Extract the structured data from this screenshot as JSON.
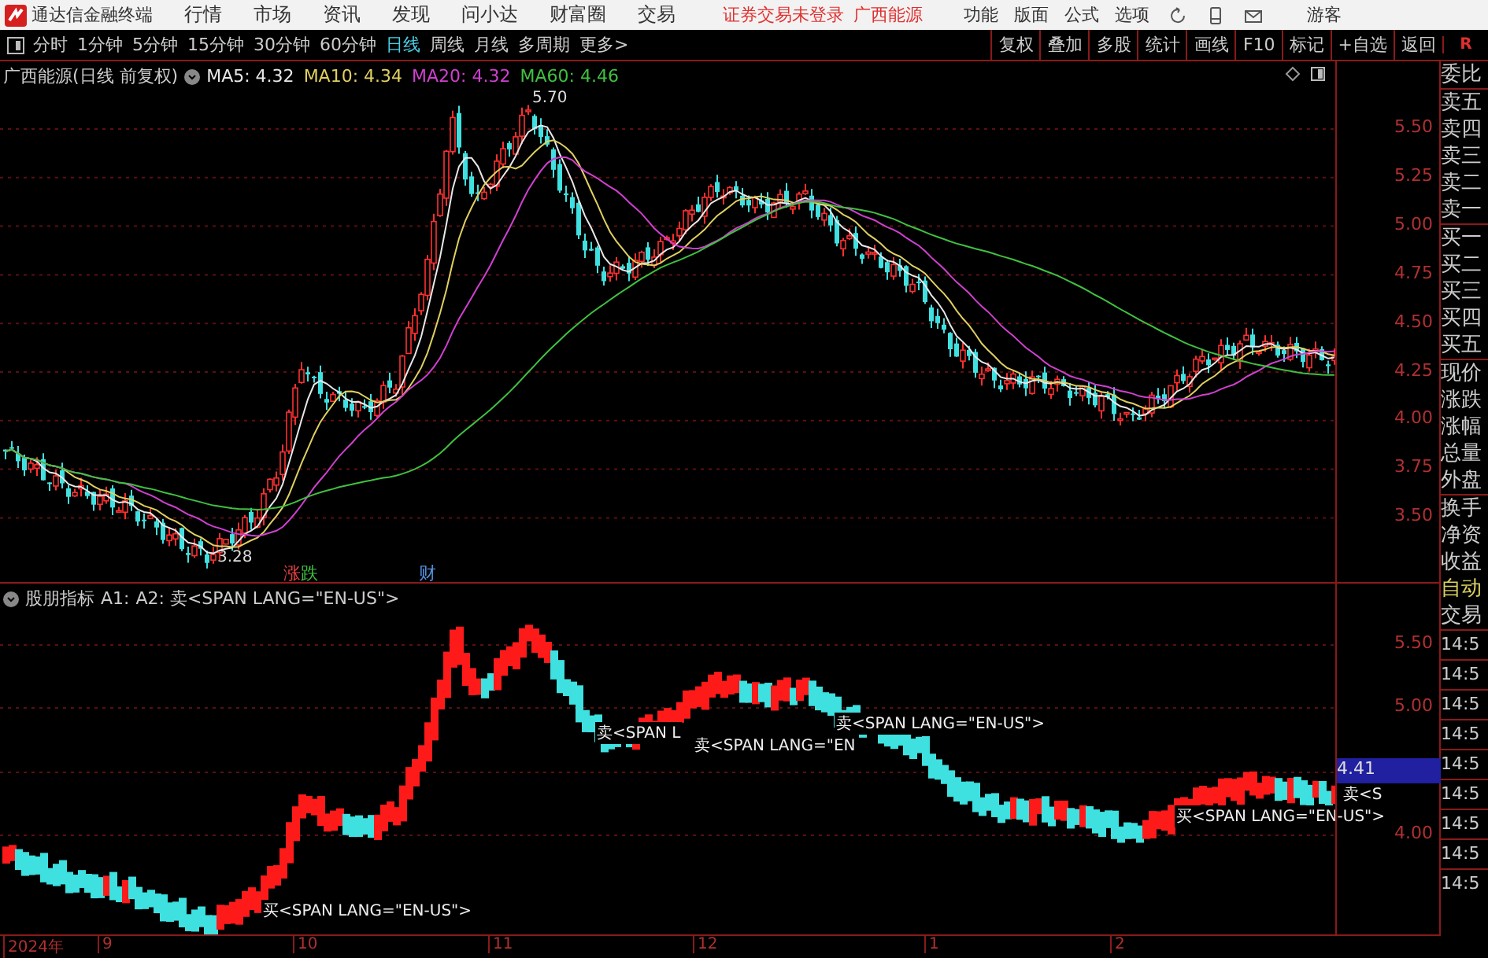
{
  "title_bar": {
    "app_name": "通达信金融终端",
    "menus": [
      "行情",
      "市场",
      "资讯",
      "发现",
      "问小达",
      "财富圈",
      "交易"
    ],
    "status": "证券交易未登录",
    "stock": "广西能源",
    "tools": [
      "功能",
      "版面",
      "公式",
      "选项"
    ],
    "user": "游客"
  },
  "toolbar": {
    "periods": [
      {
        "label": "分时",
        "selected": false
      },
      {
        "label": "1分钟",
        "selected": false
      },
      {
        "label": "5分钟",
        "selected": false
      },
      {
        "label": "15分钟",
        "selected": false
      },
      {
        "label": "30分钟",
        "selected": false
      },
      {
        "label": "60分钟",
        "selected": false
      },
      {
        "label": "日线",
        "selected": true
      },
      {
        "label": "周线",
        "selected": false
      },
      {
        "label": "月线",
        "selected": false
      },
      {
        "label": "多周期",
        "selected": false
      },
      {
        "label": "更多>",
        "selected": false
      }
    ],
    "buttons": [
      "复权",
      "叠加",
      "多股",
      "统计",
      "画线",
      "F10",
      "标记",
      "+自选",
      "返回"
    ],
    "corner": "R"
  },
  "price_chart": {
    "title": "广西能源(日线 前复权)",
    "ma": [
      {
        "label": "MA5: 4.32",
        "color": "#e8e8e8"
      },
      {
        "label": "MA10: 4.34",
        "color": "#e0d060"
      },
      {
        "label": "MA20: 4.32",
        "color": "#d040d0"
      },
      {
        "label": "MA60: 4.46",
        "color": "#40c040"
      }
    ],
    "high_label": "5.70",
    "low_label": "3.28",
    "markers": [
      {
        "label": "涨",
        "color": "#e04040"
      },
      {
        "label": "跌",
        "color": "#40c040"
      },
      {
        "label": "财",
        "color": "#5090e0"
      }
    ],
    "axis": [
      "5.50",
      "5.25",
      "5.00",
      "4.75",
      "4.50",
      "4.25",
      "4.00",
      "3.75",
      "3.50"
    ]
  },
  "indicator_chart": {
    "title": "股朋指标",
    "a1": "A1:",
    "a2": "A2: 卖<SPAN LANG=\"EN-US\">",
    "signals": [
      "买<SPAN LANG=\"EN-US\">",
      "卖<SPAN L",
      "卖<SPAN LANG=\"EN",
      "卖<SPAN LANG=\"EN-US\">",
      "卖<S",
      "买<SPAN LANG=\"EN-US\">"
    ],
    "axis": [
      "5.50",
      "5.00",
      "4.00"
    ],
    "current_price": "4.41"
  },
  "time_axis": [
    "2024年",
    "9",
    "10",
    "11",
    "12",
    "1",
    "2"
  ],
  "quote_panel": {
    "labels": [
      "委比",
      "卖五",
      "卖四",
      "卖三",
      "卖二",
      "卖一",
      "买一",
      "买二",
      "买三",
      "买四",
      "买五",
      "现价",
      "涨跌",
      "涨幅",
      "总量",
      "外盘",
      "换手",
      "净资",
      "收益"
    ],
    "tabs": [
      {
        "label": "自动",
        "selected": true
      },
      {
        "label": "交易",
        "selected": false
      }
    ],
    "times": [
      "14:5",
      "14:5",
      "14:5",
      "14:5",
      "14:5",
      "14:5",
      "14:5",
      "14:5",
      "14:5"
    ]
  }
}
